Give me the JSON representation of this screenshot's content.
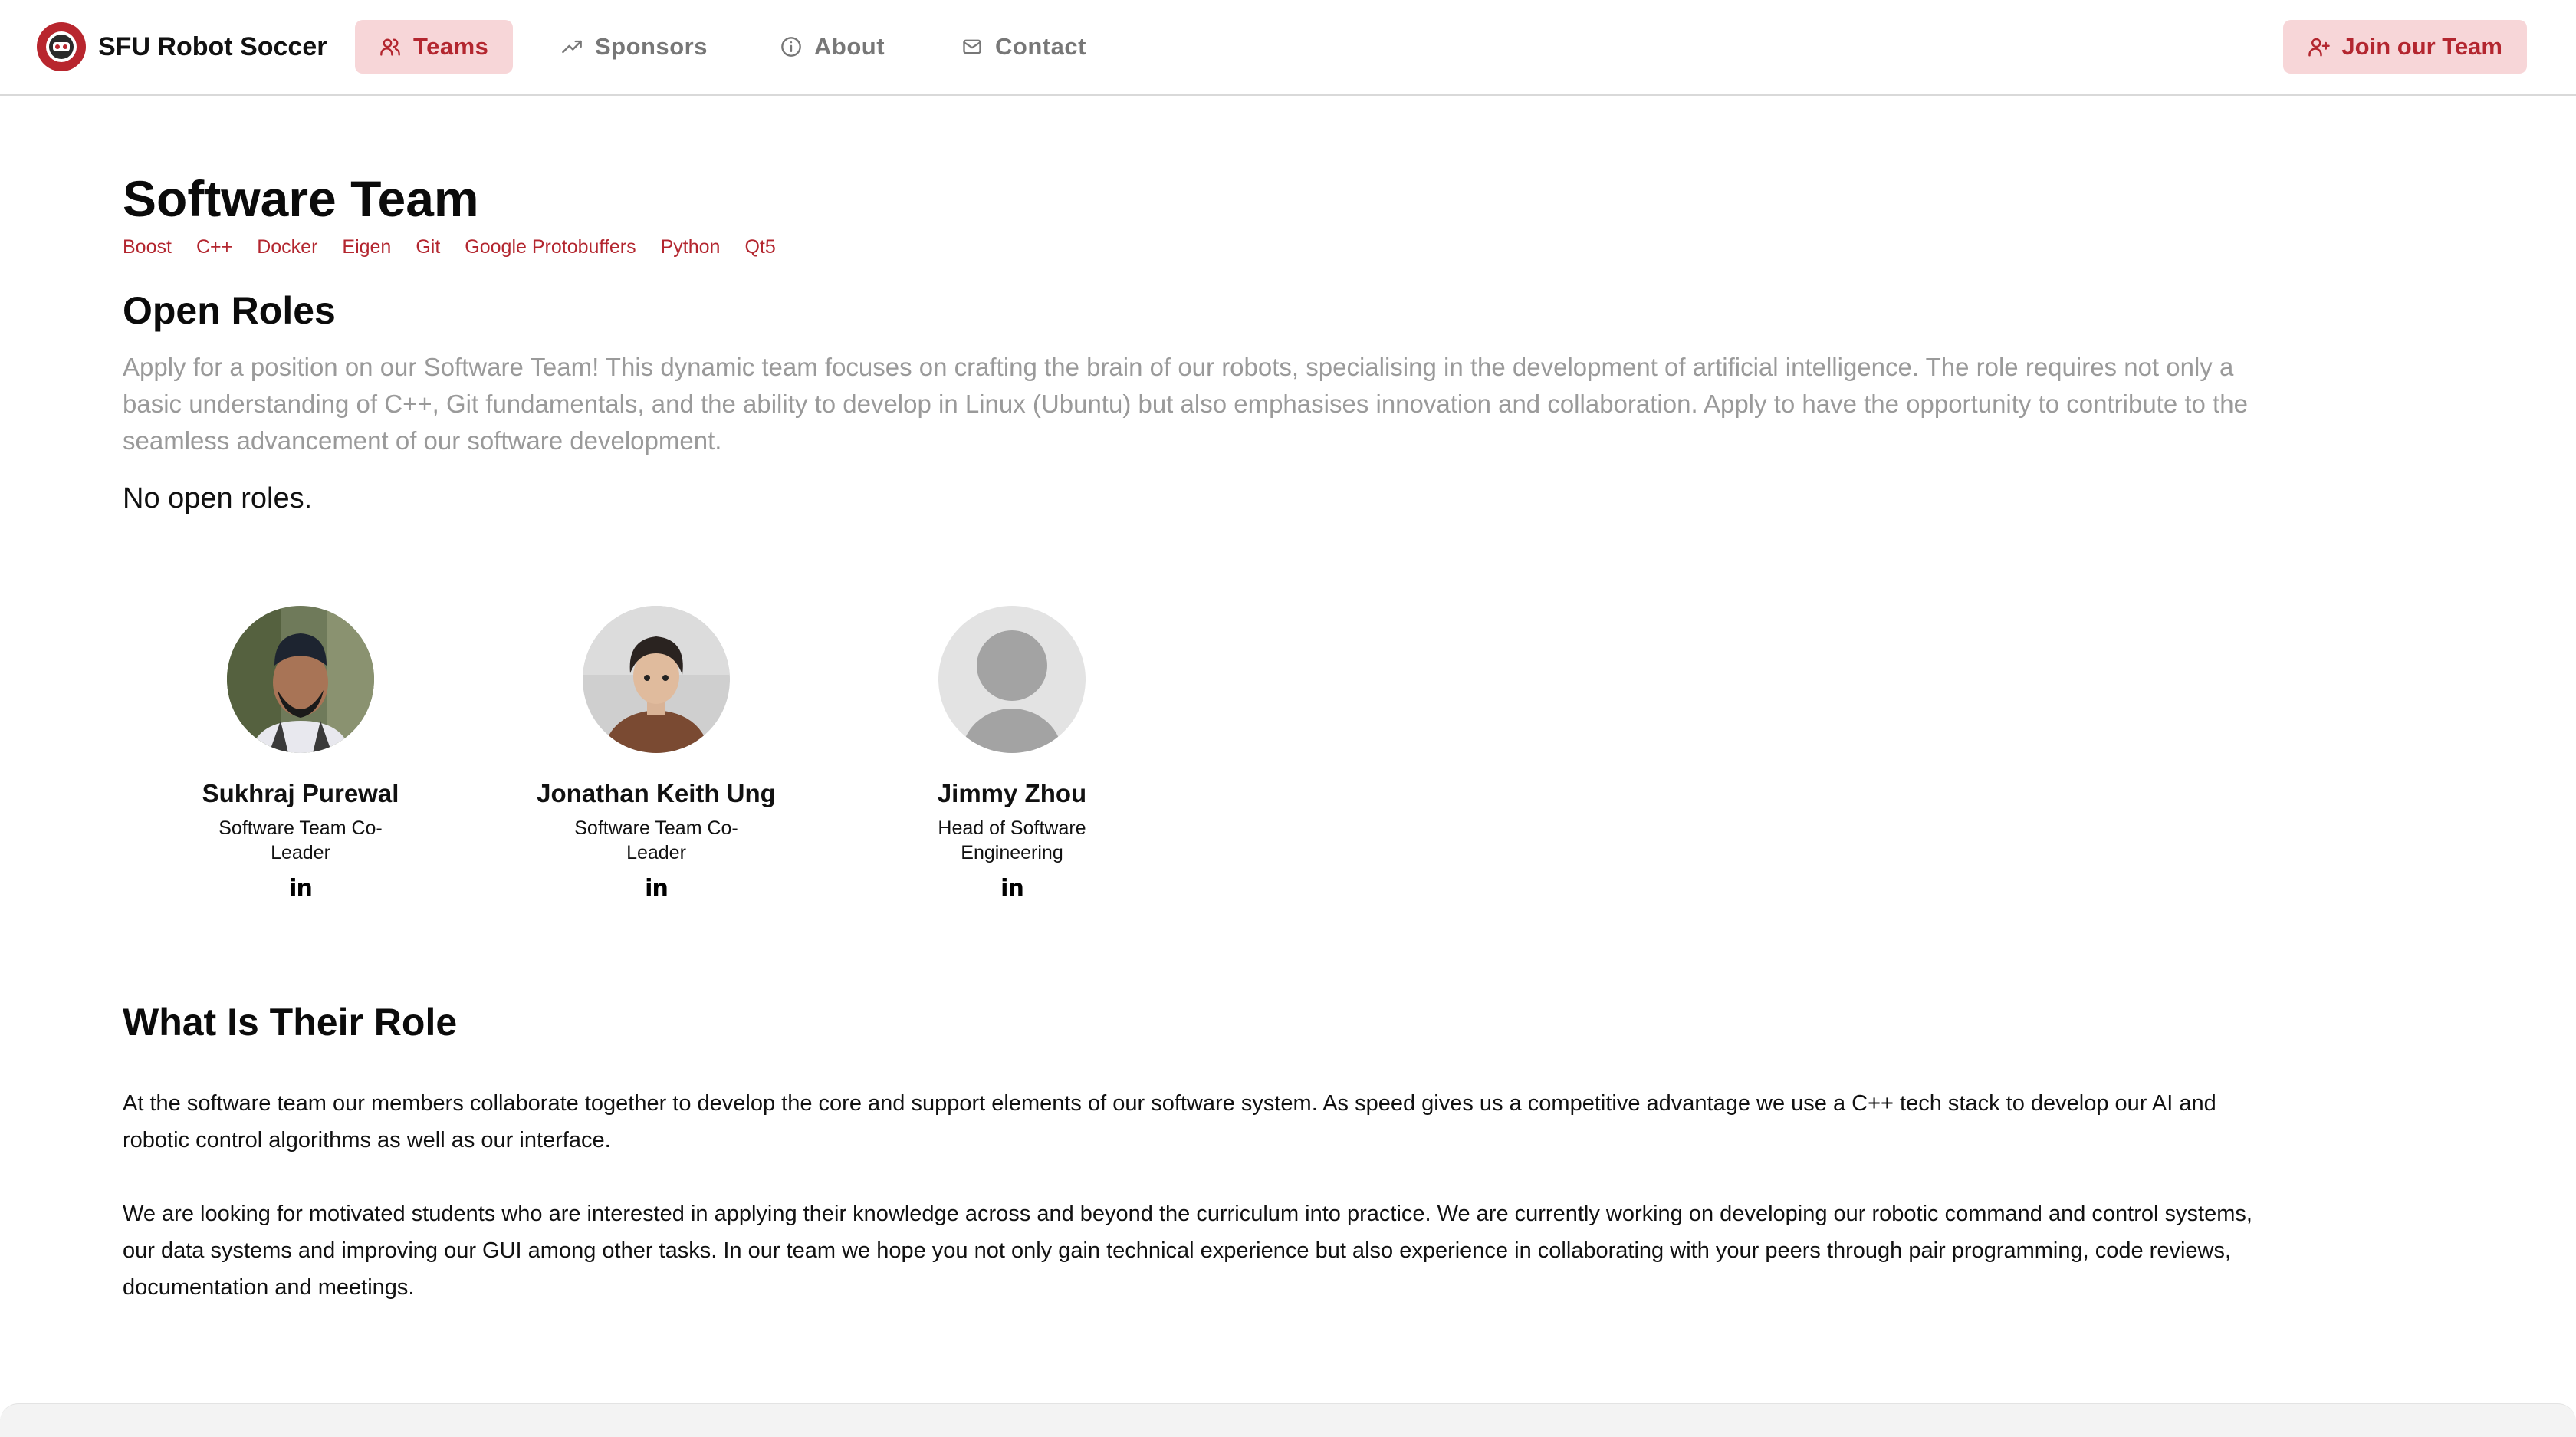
{
  "brand": {
    "name": "SFU Robot Soccer",
    "logo_icon": "robot-logo-icon",
    "accent": "#b3262f"
  },
  "nav": {
    "items": [
      {
        "label": "Teams",
        "icon": "users-icon",
        "active": true
      },
      {
        "label": "Sponsors",
        "icon": "trending-up-icon",
        "active": false
      },
      {
        "label": "About",
        "icon": "info-icon",
        "active": false
      },
      {
        "label": "Contact",
        "icon": "mail-icon",
        "active": false
      }
    ],
    "cta": {
      "label": "Join our Team",
      "icon": "user-plus-icon"
    }
  },
  "page": {
    "title": "Software Team",
    "tags": [
      "Boost",
      "C++",
      "Docker",
      "Eigen",
      "Git",
      "Google Protobuffers",
      "Python",
      "Qt5"
    ]
  },
  "open_roles": {
    "heading": "Open Roles",
    "description": "Apply for a position on our Software Team! This dynamic team focuses on crafting the brain of our robots, specialising in the development of artificial intelligence. The role requires not only a basic understanding of C++, Git fundamentals, and the ability to develop in Linux (Ubuntu) but also emphasises innovation and collaboration. Apply to have the opportunity to contribute to the seamless advancement of our software development.",
    "status": "No open roles."
  },
  "members": [
    {
      "name": "Sukhraj Purewal",
      "title": "Software Team Co-Leader",
      "social": "in",
      "social_icon": "linkedin-icon"
    },
    {
      "name": "Jonathan Keith Ung",
      "title": "Software Team Co-Leader",
      "social": "in",
      "social_icon": "linkedin-icon"
    },
    {
      "name": "Jimmy Zhou",
      "title": "Head of Software Engineering",
      "social": "in",
      "social_icon": "linkedin-icon"
    }
  ],
  "role": {
    "heading": "What Is Their Role",
    "p1": "At the software team our members collaborate together to develop the core and support elements of our software system. As speed gives us a competitive advantage we use a C++ tech stack to develop our AI and robotic control algorithms as well as our interface.",
    "p2": "We are looking for motivated students who are interested in applying their knowledge across and beyond the curriculum into practice. We are currently working on developing our robotic command and control systems, our data systems and improving our GUI among other tasks. In our team we hope you not only gain technical experience but also experience in collaborating with your peers through pair programming, code reviews, documentation and meetings."
  }
}
